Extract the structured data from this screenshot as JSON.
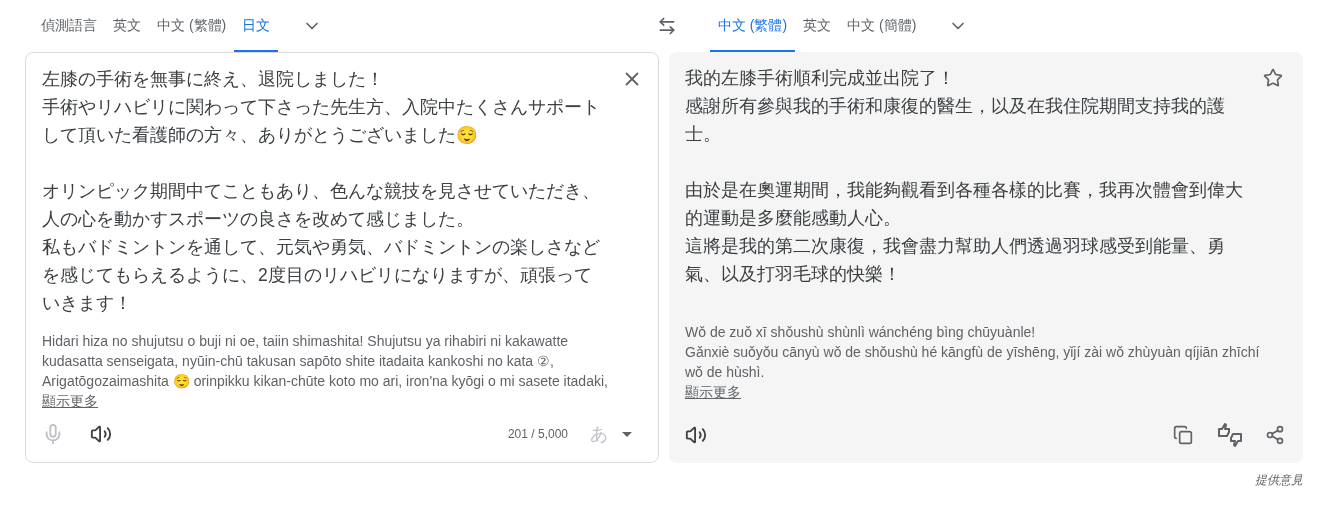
{
  "source_tabs": [
    {
      "label": "偵測語言",
      "selected": false
    },
    {
      "label": "英文",
      "selected": false
    },
    {
      "label": "中文 (繁體)",
      "selected": false
    },
    {
      "label": "日文",
      "selected": true
    }
  ],
  "target_tabs": [
    {
      "label": "中文 (繁體)",
      "selected": true
    },
    {
      "label": "英文",
      "selected": false
    },
    {
      "label": "中文 (簡體)",
      "selected": false
    }
  ],
  "source": {
    "paragraphs": [
      [
        "左膝の手術を無事に終え、退院しました！",
        "手術やリハビリに関わって下さった先生方、入院中たくさんサポート",
        "して頂いた看護師の方々、ありがとうございました😌"
      ],
      [
        "オリンピック期間中てこともあり、色んな競技を見させていただき、",
        "人の心を動かすスポーツの良さを改めて感じました。",
        "私もバドミントンを通して、元気や勇気、バドミントンの楽しさなど",
        "を感じてもらえるように、2度目のリハビリになりますが、頑張って",
        "いきます！"
      ]
    ],
    "romanization": [
      "Hidari hiza no shujutsu o buji ni oe, taiin shimashita! Shujutsu ya rihabiri ni kakawatte",
      "kudasatta senseigata, nyūin-chū takusan sapōto shite itadaita kankoshi no kata ②,",
      "Arigatōgozaimashita 😌 orinpikku kikan-chūte koto mo ari, iron'na kyōgi o mi sasete itadaki,"
    ],
    "show_more": "顯示更多",
    "char_count": "201 / 5,000",
    "input_tool": "あ",
    "mic_disabled": true
  },
  "target": {
    "paragraphs": [
      [
        "我的左膝手術順利完成並出院了！",
        "感謝所有參與我的手術和康復的醫生，以及在我住院期間支持我的護",
        "士。"
      ],
      [
        "由於是在奧運期間，我能夠觀看到各種各樣的比賽，我再次體會到偉大",
        "的運動是多麼能感動人心。",
        "這將是我的第二次康復，我會盡力幫助人們透過羽球感受到能量、勇",
        "氣、以及打羽毛球的快樂！"
      ]
    ],
    "romanization": [
      "Wǒ de zuǒ xī shǒushù shùnlì wánchéng bìng chūyuànle!",
      "Gǎnxiè suǒyǒu cānyù wǒ de shǒushù hé kāngfù de yīshēng, yǐjí zài wǒ zhùyuàn qíjiān zhīchí",
      "wǒ de hùshì."
    ],
    "show_more": "顯示更多",
    "starred": false
  },
  "feedback": "提供意見"
}
